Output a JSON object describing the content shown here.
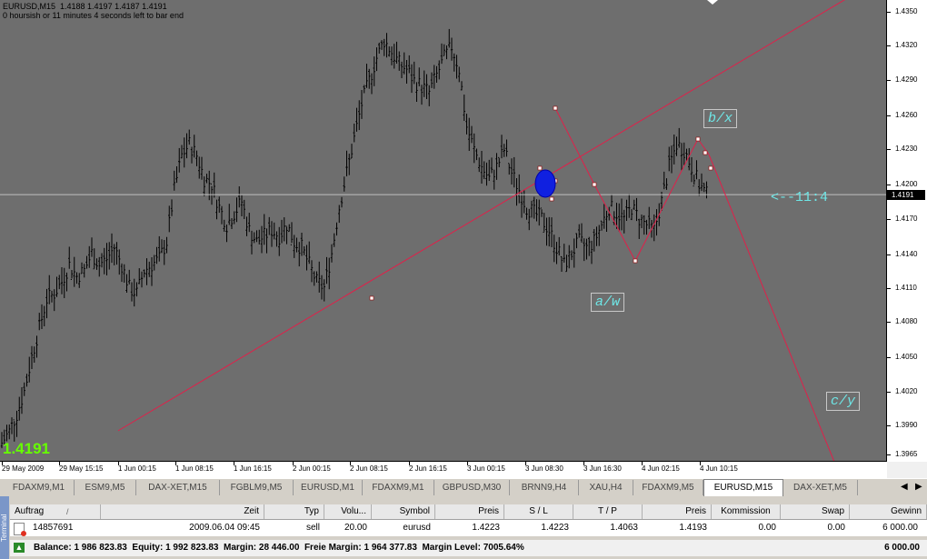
{
  "chart": {
    "title_line1": "EURUSD,M15  1.4188 1.4197 1.4187 1.4191",
    "title_line2": "0 hoursish or 11 minutes 4 seconds left to bar end",
    "current_price_big": "1.4191",
    "current_price_label": "1.4191",
    "countdown_label": "<--11:4",
    "annotations": {
      "bx": "b/x",
      "aw": "a/w",
      "cy": "c/y"
    },
    "y_ticks": [
      "1.4350",
      "1.4320",
      "1.4290",
      "1.4260",
      "1.4230",
      "1.4200",
      "1.4170",
      "1.4140",
      "1.4110",
      "1.4080",
      "1.4050",
      "1.4020",
      "1.3990",
      "1.3965"
    ],
    "x_ticks": [
      "29 May 2009",
      "29 May 15:15",
      "1 Jun 00:15",
      "1 Jun 08:15",
      "1 Jun 16:15",
      "2 Jun 00:15",
      "2 Jun 08:15",
      "2 Jun 16:15",
      "3 Jun 00:15",
      "3 Jun 08:30",
      "3 Jun 16:30",
      "4 Jun 02:15",
      "4 Jun 10:15"
    ],
    "colors": {
      "background": "#6e6e6e",
      "bars": "#000000",
      "trendline": "#e0204a",
      "price_line": "#c0c0c0",
      "annotation": "#6ee6e6",
      "current_price": "#66ff00"
    }
  },
  "chart_data": {
    "type": "ohlc",
    "symbol": "EURUSD",
    "timeframe": "M15",
    "ylim": [
      1.3965,
      1.4365
    ],
    "current_price": 1.4191,
    "close_path": [
      [
        0,
        1.3975
      ],
      [
        3,
        1.3985
      ],
      [
        6,
        1.4
      ],
      [
        9,
        1.402
      ],
      [
        12,
        1.405
      ],
      [
        15,
        1.4075
      ],
      [
        18,
        1.41
      ],
      [
        21,
        1.4105
      ],
      [
        24,
        1.4115
      ],
      [
        27,
        1.413
      ],
      [
        30,
        1.412
      ],
      [
        33,
        1.4125
      ],
      [
        36,
        1.414
      ],
      [
        39,
        1.413
      ],
      [
        42,
        1.4135
      ],
      [
        45,
        1.4145
      ],
      [
        48,
        1.413
      ],
      [
        51,
        1.411
      ],
      [
        54,
        1.4105
      ],
      [
        57,
        1.4125
      ],
      [
        60,
        1.413
      ],
      [
        63,
        1.4135
      ],
      [
        66,
        1.415
      ],
      [
        69,
        1.4195
      ],
      [
        72,
        1.4225
      ],
      [
        75,
        1.4235
      ],
      [
        78,
        1.4225
      ],
      [
        81,
        1.4205
      ],
      [
        84,
        1.42
      ],
      [
        87,
        1.418
      ],
      [
        90,
        1.4165
      ],
      [
        93,
        1.4175
      ],
      [
        96,
        1.4185
      ],
      [
        99,
        1.416
      ],
      [
        102,
        1.415
      ],
      [
        105,
        1.4155
      ],
      [
        108,
        1.416
      ],
      [
        111,
        1.4155
      ],
      [
        114,
        1.4165
      ],
      [
        117,
        1.415
      ],
      [
        120,
        1.4145
      ],
      [
        123,
        1.413
      ],
      [
        126,
        1.4115
      ],
      [
        129,
        1.411
      ],
      [
        132,
        1.414
      ],
      [
        135,
        1.418
      ],
      [
        138,
        1.421
      ],
      [
        141,
        1.424
      ],
      [
        144,
        1.427
      ],
      [
        147,
        1.429
      ],
      [
        150,
        1.431
      ],
      [
        153,
        1.4325
      ],
      [
        156,
        1.4315
      ],
      [
        159,
        1.4305
      ],
      [
        162,
        1.43
      ],
      [
        165,
        1.429
      ],
      [
        168,
        1.4285
      ],
      [
        171,
        1.428
      ],
      [
        174,
        1.4295
      ],
      [
        177,
        1.431
      ],
      [
        180,
        1.432
      ],
      [
        183,
        1.43
      ],
      [
        186,
        1.425
      ],
      [
        189,
        1.423
      ],
      [
        192,
        1.4215
      ],
      [
        195,
        1.4205
      ],
      [
        198,
        1.4215
      ],
      [
        201,
        1.423
      ],
      [
        204,
        1.421
      ],
      [
        207,
        1.4195
      ],
      [
        210,
        1.418
      ],
      [
        213,
        1.4175
      ],
      [
        216,
        1.417
      ],
      [
        219,
        1.416
      ],
      [
        222,
        1.4145
      ],
      [
        225,
        1.413
      ],
      [
        228,
        1.414
      ],
      [
        231,
        1.415
      ],
      [
        234,
        1.4145
      ],
      [
        237,
        1.415
      ],
      [
        240,
        1.4165
      ],
      [
        243,
        1.418
      ],
      [
        246,
        1.4175
      ],
      [
        249,
        1.417
      ],
      [
        252,
        1.418
      ],
      [
        255,
        1.417
      ],
      [
        258,
        1.4165
      ],
      [
        261,
        1.416
      ],
      [
        264,
        1.4185
      ],
      [
        267,
        1.4215
      ],
      [
        270,
        1.4235
      ],
      [
        273,
        1.423
      ],
      [
        276,
        1.4215
      ],
      [
        279,
        1.42
      ],
      [
        282,
        1.4191
      ]
    ],
    "trend_points": [
      {
        "bar": 136,
        "price": 1.4101
      },
      {
        "bar": 212,
        "price": 1.4199
      }
    ]
  },
  "tabs": [
    "FDAXM9,M1",
    "ESM9,M5",
    "DAX-XET,M15",
    "FGBLM9,M5",
    "EURUSD,M1",
    "FDAXM9,M1",
    "GBPUSD,M30",
    "BRNN9,H4",
    "XAU,H4",
    "FDAXM9,M5",
    "EURUSD,M15",
    "DAX-XET,M5"
  ],
  "active_tab": "EURUSD,M15",
  "terminal": {
    "side_label": "Terminal",
    "headers": [
      "Auftrag",
      "Zeit",
      "Typ",
      "Volu...",
      "Symbol",
      "Preis",
      "S / L",
      "T / P",
      "Preis",
      "Kommission",
      "Swap",
      "Gewinn"
    ],
    "order": {
      "ticket": "14857691",
      "time": "2009.06.04 09:45",
      "type": "sell",
      "volume": "20.00",
      "symbol": "eurusd",
      "price": "1.4223",
      "sl": "1.4223",
      "tp": "1.4063",
      "cur_price": "1.4193",
      "commission": "0.00",
      "swap": "0.00",
      "profit": "6 000.00"
    },
    "balance_line": "Balance: 1 986 823.83  Equity: 1 992 823.83  Margin: 28 446.00  Freie Margin: 1 964 377.83  Margin Level: 7005.64%",
    "balance_profit": "6 000.00"
  }
}
